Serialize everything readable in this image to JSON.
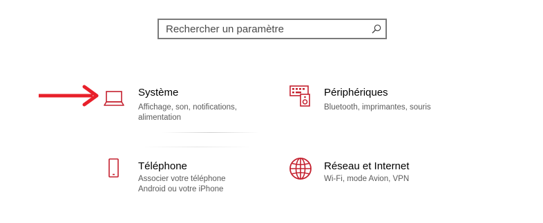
{
  "search": {
    "placeholder": "Rechercher un paramètre"
  },
  "tiles": [
    {
      "title": "Système",
      "description": "Affichage, son, notifications, alimentation",
      "icon": "laptop-icon"
    },
    {
      "title": "Périphériques",
      "description": "Bluetooth, imprimantes, souris",
      "icon": "keyboard-speaker-icon"
    },
    {
      "title": "Téléphone",
      "description": "Associer votre téléphone Android ou votre iPhone",
      "icon": "phone-icon"
    },
    {
      "title": "Réseau et Internet",
      "description": "Wi-Fi, mode Avion, VPN",
      "icon": "globe-icon"
    }
  ],
  "colors": {
    "accent": "#c4202e",
    "arrow": "#e8202a"
  }
}
